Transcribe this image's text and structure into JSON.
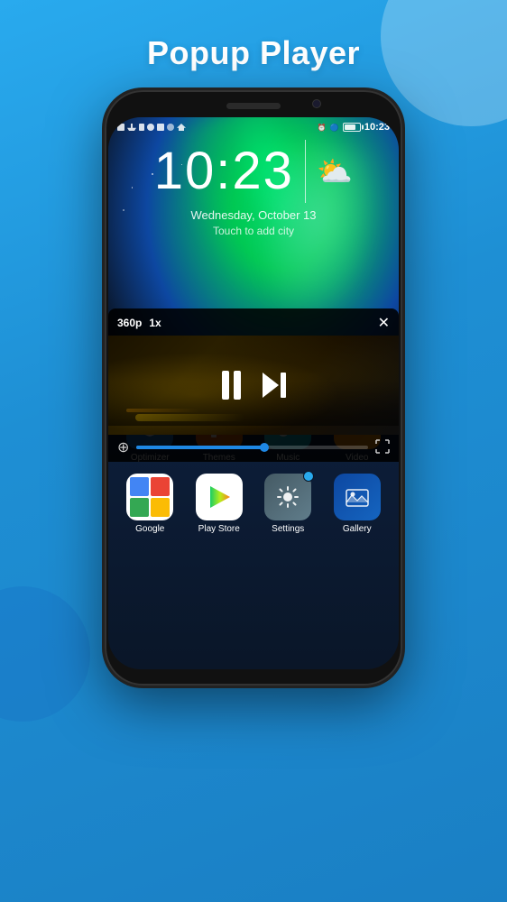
{
  "page": {
    "title": "Popup Player",
    "background_color": "#29aaee"
  },
  "phone": {
    "status_bar": {
      "time": "10:23",
      "left_icons": [
        "sim",
        "wifi",
        "signal",
        "rotate",
        "sync",
        "brightness",
        "alarm"
      ],
      "right_icons": [
        "alarm",
        "bluetooth",
        "battery"
      ]
    },
    "lock_screen": {
      "time": "10:23",
      "date": "Wednesday, October 13",
      "city_hint": "Touch to add city"
    },
    "popup_player": {
      "resolution": "360p",
      "speed": "1x",
      "close_label": "×",
      "progress_percent": 55
    },
    "app_row1": [
      {
        "label": "Optimizer",
        "icon_type": "optimizer",
        "has_badge": true
      },
      {
        "label": "Themes",
        "icon_type": "themes",
        "has_badge": false
      },
      {
        "label": "Music",
        "icon_type": "music",
        "has_badge": false
      },
      {
        "label": "Video",
        "icon_type": "video",
        "has_badge": false
      }
    ],
    "app_row2": [
      {
        "label": "Google",
        "icon_type": "google",
        "has_badge": false
      },
      {
        "label": "Play Store",
        "icon_type": "playstore",
        "has_badge": false
      },
      {
        "label": "Settings",
        "icon_type": "settings",
        "has_badge": false
      },
      {
        "label": "Gallery",
        "icon_type": "gallery",
        "has_badge": false
      }
    ]
  }
}
